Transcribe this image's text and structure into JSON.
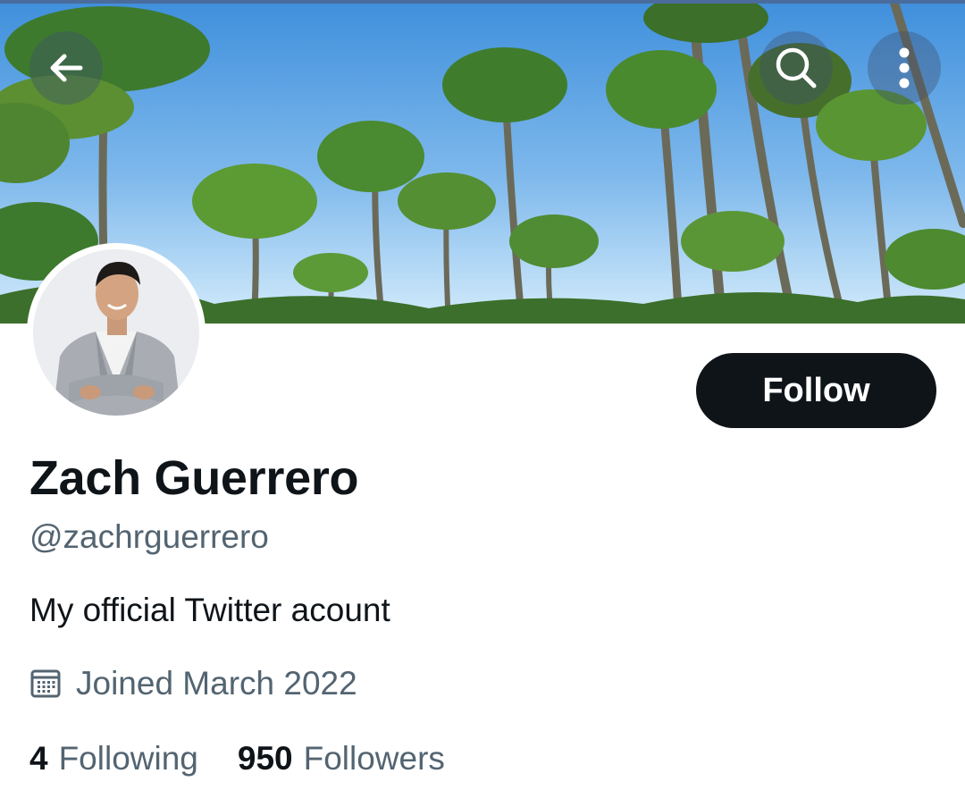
{
  "header": {
    "back_icon": "arrow-left-icon",
    "search_icon": "search-icon",
    "more_icon": "more-vertical-icon"
  },
  "profile": {
    "display_name": "Zach Guerrero",
    "handle": "@zachrguerrero",
    "bio": "My official Twitter acount",
    "joined": "Joined March 2022",
    "joined_icon": "calendar-icon",
    "following_count": "4",
    "following_label": "Following",
    "followers_count": "950",
    "followers_label": "Followers"
  },
  "actions": {
    "follow_label": "Follow"
  },
  "colors": {
    "primary_text": "#0f1419",
    "secondary_text": "#536471",
    "follow_button_bg": "#0f1419",
    "follow_button_text": "#ffffff"
  }
}
